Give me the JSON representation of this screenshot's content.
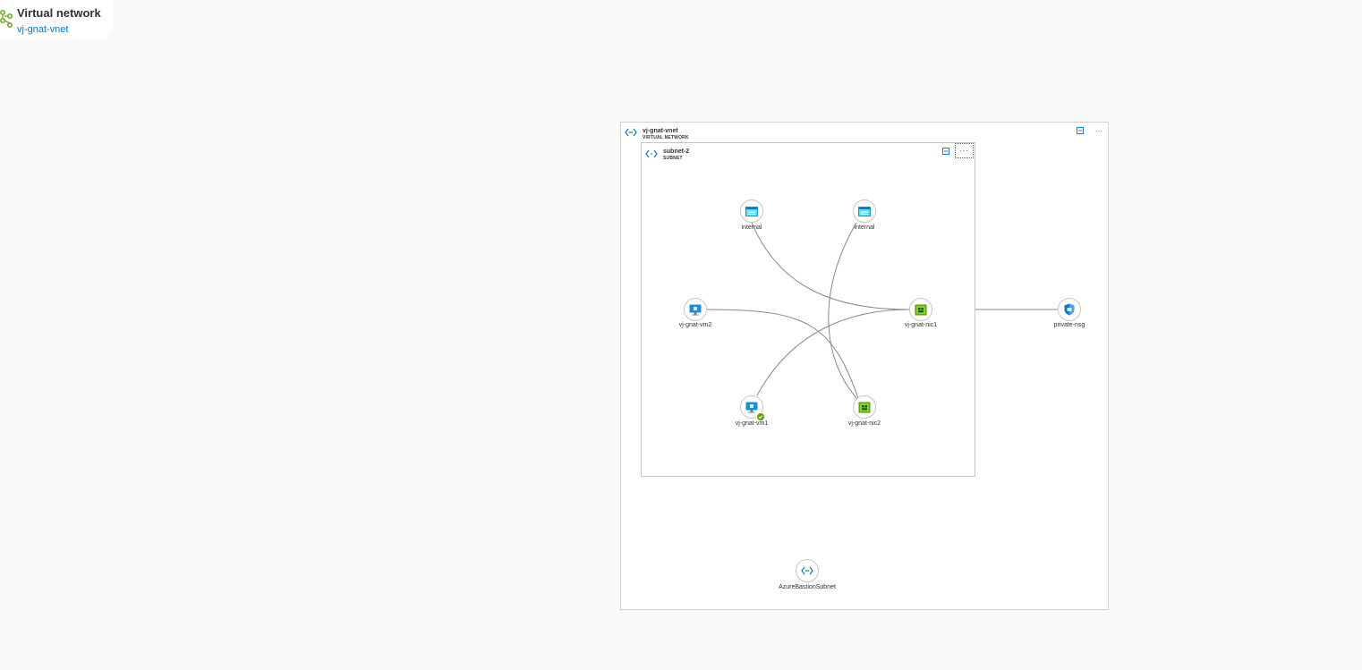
{
  "header": {
    "title": "Virtual network",
    "resource_link": "vj-gnat-vnet",
    "icon": "virtual-network-icon"
  },
  "vnet": {
    "name": "vj-gnat-vnet",
    "type_label": "VIRTUAL NETWORK",
    "icon": "vnet-brackets-icon"
  },
  "subnet": {
    "name": "subnet-2",
    "type_label": "SUBNET",
    "more_label": "···"
  },
  "toolbar": {
    "more_label": "···"
  },
  "nodes": {
    "internal1": {
      "label": "internal",
      "icon": "route-table-icon"
    },
    "internal2": {
      "label": "internal",
      "icon": "route-table-icon"
    },
    "vm2": {
      "label": "vj-gnat-vm2",
      "icon": "virtual-machine-icon"
    },
    "nic1": {
      "label": "vj-gnat-nic1",
      "icon": "network-interface-icon"
    },
    "vm1": {
      "label": "vj-gnat-vm1",
      "icon": "virtual-machine-icon",
      "status": "running"
    },
    "nic2": {
      "label": "vj-gnat-nic2",
      "icon": "network-interface-icon"
    },
    "nsg": {
      "label": "private-nsg",
      "icon": "network-security-group-icon"
    },
    "bastion": {
      "label": "AzureBastionSubnet",
      "icon": "subnet-icon"
    }
  },
  "colors": {
    "link": "#0078d4",
    "vm_blue": "#1490df",
    "nic_green": "#5ea0ef",
    "check_green": "#57a300"
  }
}
